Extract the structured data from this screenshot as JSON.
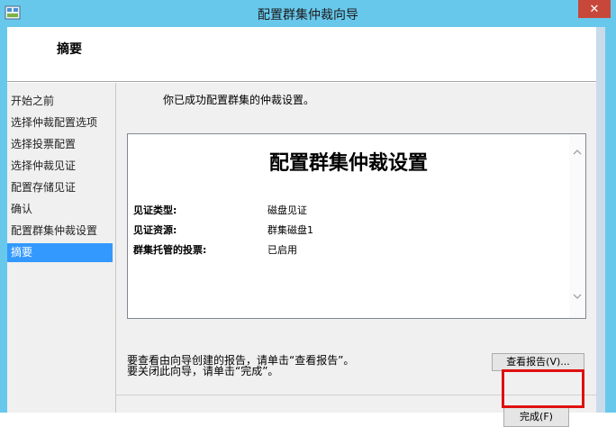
{
  "window": {
    "title": "配置群集仲裁向导",
    "close_symbol": "✕"
  },
  "header": {
    "title": "摘要"
  },
  "nav": {
    "items": [
      {
        "label": "开始之前"
      },
      {
        "label": "选择仲裁配置选项"
      },
      {
        "label": "选择投票配置"
      },
      {
        "label": "选择仲裁见证"
      },
      {
        "label": "配置存储见证"
      },
      {
        "label": "确认"
      },
      {
        "label": "配置群集仲裁设置"
      },
      {
        "label": "摘要",
        "selected": true
      }
    ]
  },
  "content": {
    "success_message": "你已成功配置群集的仲裁设置。",
    "report": {
      "heading": "配置群集仲裁设置",
      "fields": [
        {
          "label": "见证类型:",
          "value": "磁盘见证"
        },
        {
          "label": "见证资源:",
          "value": "群集磁盘1"
        },
        {
          "label": "群集托管的投票:",
          "value": "已启用"
        }
      ]
    },
    "hint_line1": "要查看由向导创建的报告，请单击“查看报告”。",
    "hint_line2": "要关闭此向导，请单击“完成”。",
    "view_report_button": "查看报告(V)...",
    "finish_button": "完成(F)"
  },
  "colors": {
    "title_bar": "#68c8ec",
    "selected_nav": "#3399ff",
    "close_button": "#c7483b",
    "annotation_rect": "#e01010"
  }
}
